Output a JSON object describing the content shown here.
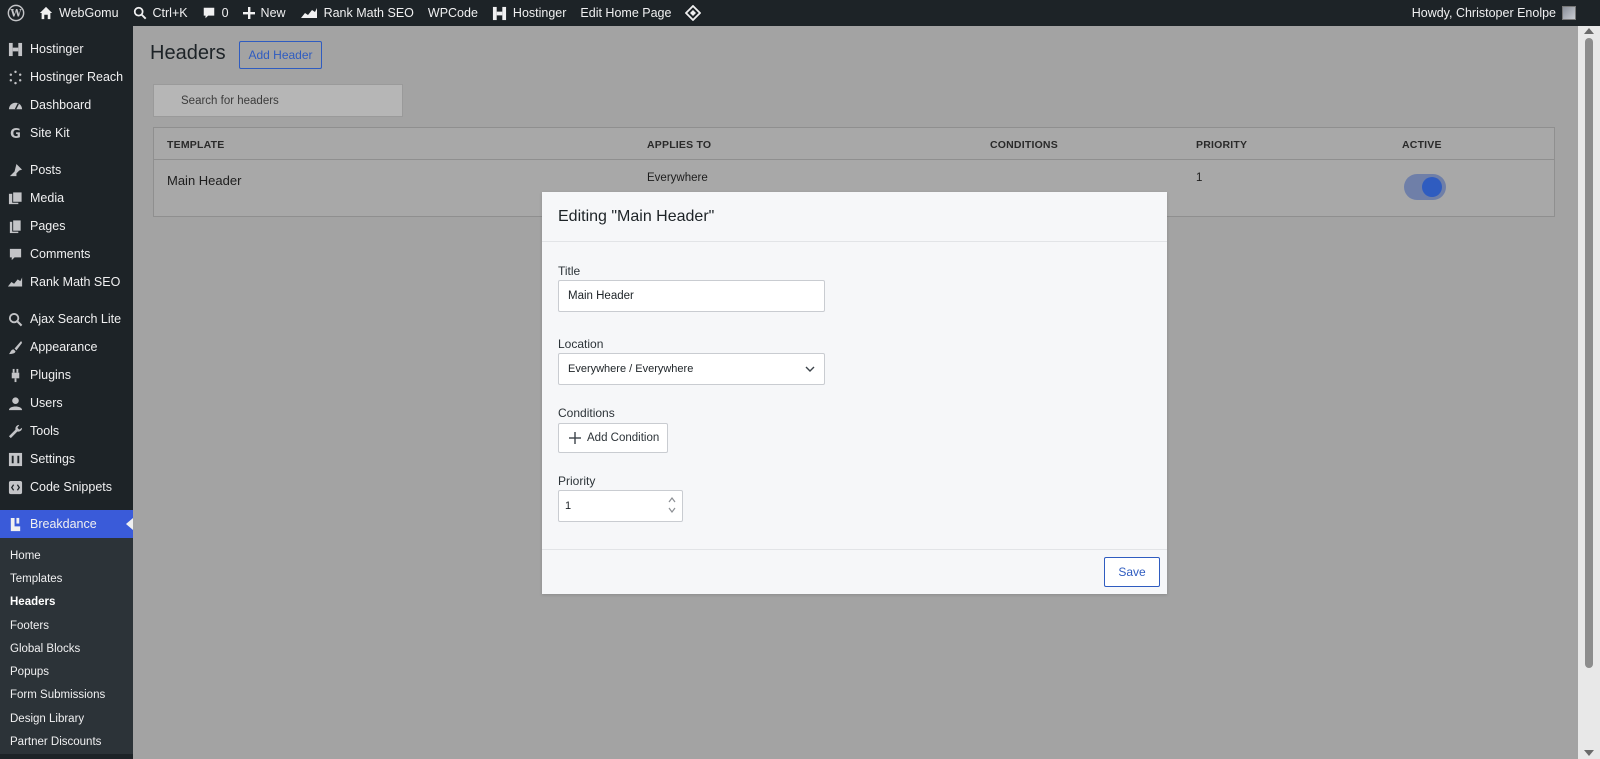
{
  "adminbar": {
    "site_name": "WebGomu",
    "search_shortcut": "Ctrl+K",
    "comments_count": "0",
    "new_label": "New",
    "rankmath_label": "Rank Math SEO",
    "wpcode_label": "WPCode",
    "hostinger_label": "Hostinger",
    "edit_page_label": "Edit Home Page",
    "howdy": "Howdy, Christoper Enolpe"
  },
  "sidebar": {
    "items": [
      {
        "label": "Hostinger",
        "icon": "hostinger-icon"
      },
      {
        "label": "Hostinger Reach",
        "icon": "reach-icon"
      },
      {
        "label": "Dashboard",
        "icon": "dashboard-icon"
      },
      {
        "label": "Site Kit",
        "icon": "google-icon"
      },
      {
        "label": "Posts",
        "icon": "pin-icon"
      },
      {
        "label": "Media",
        "icon": "media-icon"
      },
      {
        "label": "Pages",
        "icon": "pages-icon"
      },
      {
        "label": "Comments",
        "icon": "comment-icon"
      },
      {
        "label": "Rank Math SEO",
        "icon": "rankmath-icon"
      },
      {
        "label": "Ajax Search Lite",
        "icon": "search-icon"
      },
      {
        "label": "Appearance",
        "icon": "brush-icon"
      },
      {
        "label": "Plugins",
        "icon": "plug-icon"
      },
      {
        "label": "Users",
        "icon": "user-icon"
      },
      {
        "label": "Tools",
        "icon": "wrench-icon"
      },
      {
        "label": "Settings",
        "icon": "settings-icon"
      },
      {
        "label": "Code Snippets",
        "icon": "code-icon"
      },
      {
        "label": "Breakdance",
        "icon": "breakdance-icon"
      }
    ],
    "submenu": [
      "Home",
      "Templates",
      "Headers",
      "Footers",
      "Global Blocks",
      "Popups",
      "Form Submissions",
      "Design Library",
      "Partner Discounts"
    ]
  },
  "page": {
    "title": "Headers",
    "add_button": "Add Header",
    "search_placeholder": "Search for headers"
  },
  "table": {
    "headers": [
      "TEMPLATE",
      "APPLIES TO",
      "CONDITIONS",
      "PRIORITY",
      "ACTIVE"
    ],
    "rows": [
      {
        "template": "Main Header",
        "applies_to": "Everywhere",
        "conditions": "",
        "priority": "1",
        "active": true
      }
    ]
  },
  "modal": {
    "title": "Editing \"Main Header\"",
    "title_label": "Title",
    "title_value": "Main Header",
    "location_label": "Location",
    "location_value": "Everywhere / Everywhere",
    "conditions_label": "Conditions",
    "add_condition": "Add Condition",
    "priority_label": "Priority",
    "priority_value": "1",
    "save": "Save"
  },
  "colors": {
    "accent": "#2f5cc0",
    "admin_bg": "#1d2327",
    "overlay": "#a3a3a3"
  }
}
